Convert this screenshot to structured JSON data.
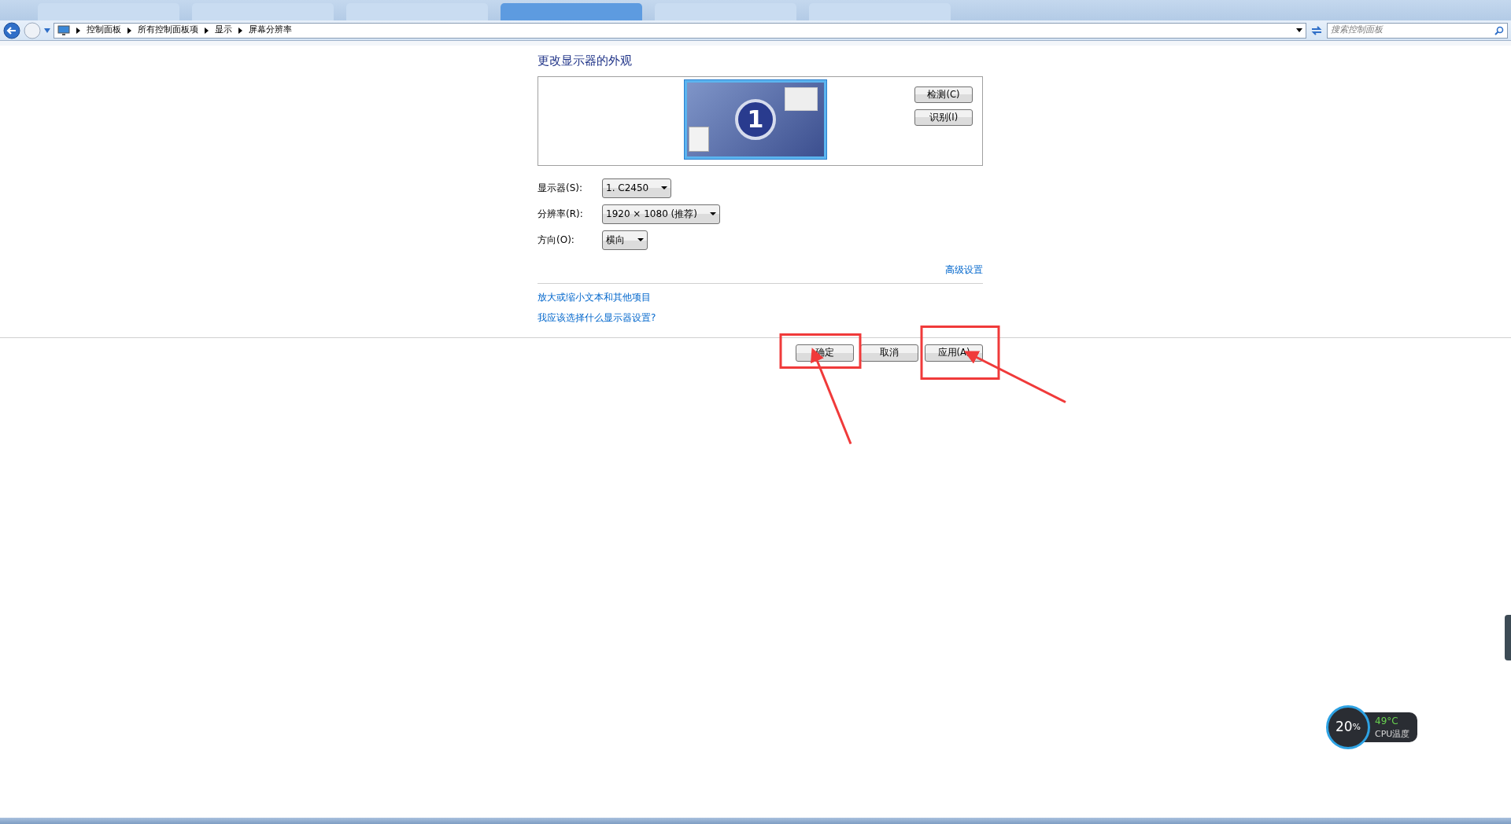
{
  "breadcrumb": [
    "控制面板",
    "所有控制面板项",
    "显示",
    "屏幕分辨率"
  ],
  "search": {
    "placeholder": "搜索控制面板"
  },
  "heading": "更改显示器的外观",
  "monitor": {
    "number": "1",
    "selected": true
  },
  "side_buttons": [
    "检测(C)",
    "识别(I)"
  ],
  "fields": [
    {
      "label": "显示器(S):",
      "value": "1. C2450"
    },
    {
      "label": "分辨率(R):",
      "value": "1920 × 1080 (推荐)"
    },
    {
      "label": "方向(O):",
      "value": "横向"
    }
  ],
  "advanced_link": "高级设置",
  "links": [
    "放大或缩小文本和其他项目",
    "我应该选择什么显示器设置?"
  ],
  "buttons": [
    {
      "label": "确定",
      "highlighted": true
    },
    {
      "label": "取消",
      "highlighted": false
    },
    {
      "label": "应用(A)",
      "highlighted": true
    }
  ],
  "cpu_widget": {
    "usage": "20",
    "unit": "%",
    "temperature": "49°C",
    "caption": "CPU温度"
  }
}
